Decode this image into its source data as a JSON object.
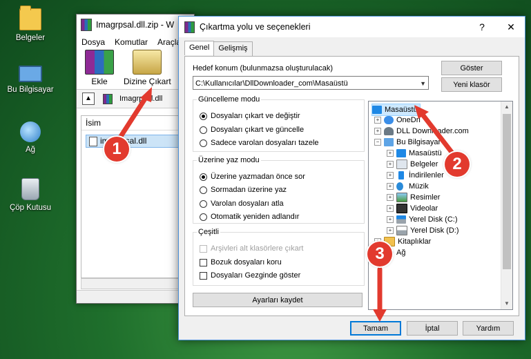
{
  "desktop": {
    "icons": [
      {
        "label": "Belgeler",
        "icon": "folder-icon"
      },
      {
        "label": "Bu Bilgisayar",
        "icon": "computer-icon"
      },
      {
        "label": "Ağ",
        "icon": "network-icon"
      },
      {
        "label": "Çöp Kutusu",
        "icon": "recycle-bin-icon"
      }
    ]
  },
  "winrar": {
    "title": "Imagrpsal.dll.zip - W",
    "menu": [
      "Dosya",
      "Komutlar",
      "Araçla"
    ],
    "toolbar": {
      "add": "Ekle",
      "extract_to": "Dizine Çıkart"
    },
    "address": "Imagrpsal.dll",
    "column_name": "İsim",
    "file": "imagrpsal.dll"
  },
  "dialog": {
    "title": "Çıkartma yolu ve seçenekleri",
    "help": "?",
    "close": "✕",
    "tabs": [
      "Genel",
      "Gelişmiş"
    ],
    "dest_label": "Hedef konum (bulunmazsa oluşturulacak)",
    "dest_value": "C:\\Kullanıcılar\\DllDownloader_com\\Masaüstü",
    "show_button": "Göster",
    "new_folder_button": "Yeni klasör",
    "update_mode": {
      "title": "Güncelleme modu",
      "options": [
        "Dosyaları çıkart ve değiştir",
        "Dosyaları çıkart ve güncelle",
        "Sadece varolan dosyaları tazele"
      ],
      "selected": 0
    },
    "overwrite_mode": {
      "title": "Üzerine yaz modu",
      "options": [
        "Üzerine yazmadan önce sor",
        "Sormadan üzerine yaz",
        "Varolan dosyaları atla",
        "Otomatik yeniden adlandır"
      ],
      "selected": 0
    },
    "misc": {
      "title": "Çeşitli",
      "options": [
        "Arşivleri alt klasörlere çıkart",
        "Bozuk dosyaları koru",
        "Dosyaları Gezginde göster"
      ],
      "disabled": [
        true,
        false,
        false
      ]
    },
    "save_settings": "Ayarları kaydet",
    "tree": [
      {
        "label": "Masaüstü",
        "level": 0,
        "selected": true,
        "icon": "desktop-icon"
      },
      {
        "label": "OneDri",
        "level": 1,
        "icon": "onedrive-icon"
      },
      {
        "label": "DLL Downloader.com",
        "level": 1,
        "icon": "user-icon"
      },
      {
        "label": "Bu Bilgisayar",
        "level": 1,
        "icon": "computer-icon"
      },
      {
        "label": "Masaüstü",
        "level": 2,
        "icon": "desktop-icon"
      },
      {
        "label": "Belgeler",
        "level": 2,
        "icon": "documents-icon"
      },
      {
        "label": "İndirilenler",
        "level": 2,
        "icon": "downloads-icon"
      },
      {
        "label": "Müzik",
        "level": 2,
        "icon": "music-icon"
      },
      {
        "label": "Resimler",
        "level": 2,
        "icon": "pictures-icon"
      },
      {
        "label": "Videolar",
        "level": 2,
        "icon": "videos-icon"
      },
      {
        "label": "Yerel Disk (C:)",
        "level": 2,
        "icon": "drive-icon"
      },
      {
        "label": "Yerel Disk (D:)",
        "level": 2,
        "icon": "drive-icon"
      },
      {
        "label": "Kitaplıklar",
        "level": 1,
        "icon": "libraries-icon"
      },
      {
        "label": "Ağ",
        "level": 1,
        "icon": "network-icon"
      }
    ],
    "ok": "Tamam",
    "cancel": "İptal",
    "help_button": "Yardım"
  },
  "annotations": [
    "1",
    "2",
    "3"
  ],
  "colors": {
    "badge": "#e23a2e",
    "selection": "#cce8ff",
    "accent": "#0078d7"
  }
}
